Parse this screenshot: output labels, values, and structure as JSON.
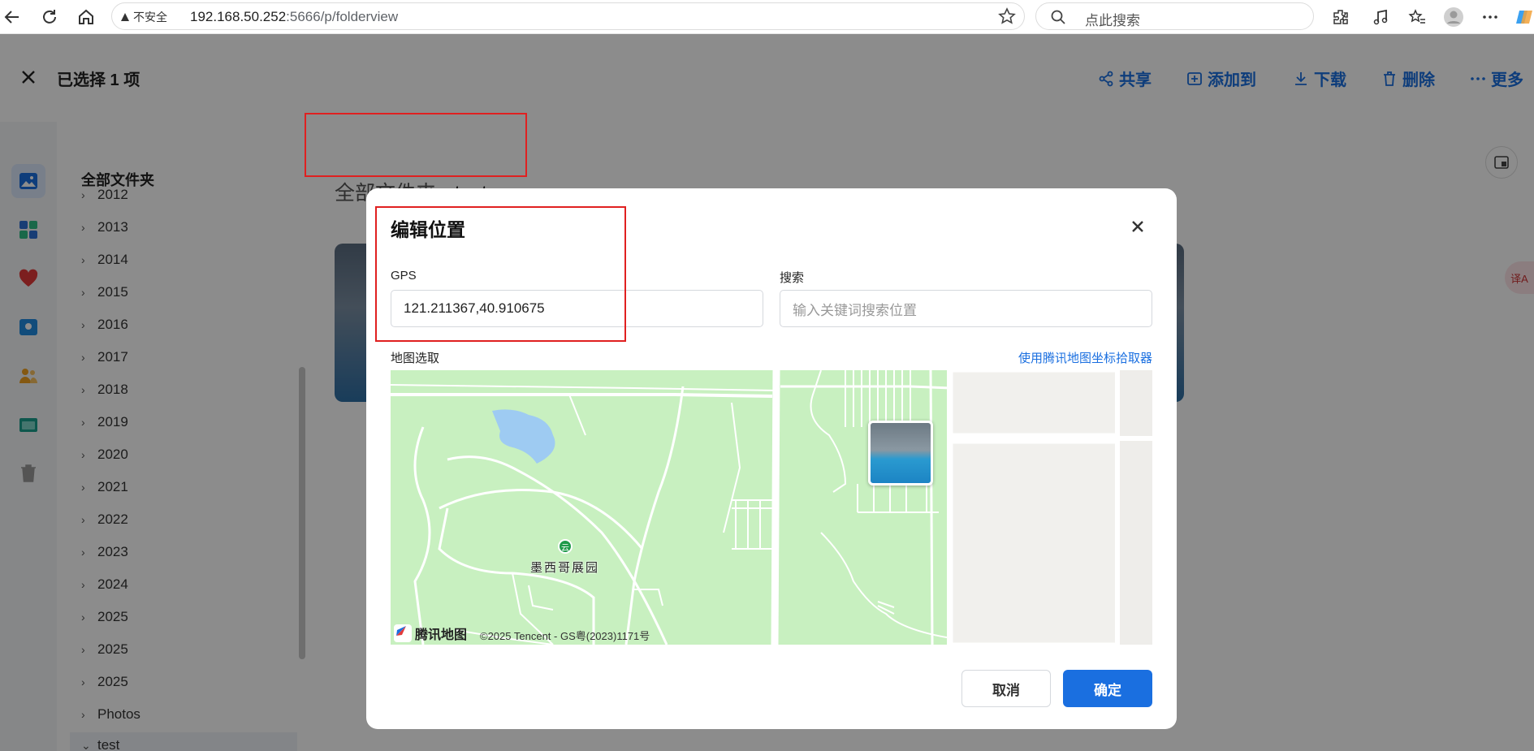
{
  "browser": {
    "insecure_label": "不安全",
    "url_host": "192.168.50.252",
    "url_path": ":5666/p/folderview",
    "search_placeholder": "点此搜索"
  },
  "header": {
    "selected_label": "已选择 1 项",
    "actions": {
      "share": "共享",
      "add_to": "添加到",
      "download": "下载",
      "delete": "删除",
      "more": "更多"
    }
  },
  "tree": {
    "heading": "全部文件夹",
    "items": [
      "2012",
      "2013",
      "2014",
      "2015",
      "2016",
      "2017",
      "2018",
      "2019",
      "2020",
      "2021",
      "2022",
      "2023",
      "2024",
      "2025",
      "2025",
      "2025",
      "Photos",
      "test"
    ]
  },
  "breadcrumb": {
    "root": "全部文件夹",
    "separator": "›",
    "current": "test"
  },
  "translate_badge": "译A",
  "modal": {
    "title": "编辑位置",
    "gps_label": "GPS",
    "gps_value": "121.211367,40.910675",
    "search_label": "搜索",
    "search_placeholder": "输入关键词搜索位置",
    "map_label": "地图选取",
    "map_link": "使用腾讯地图坐标拾取器",
    "map_logo_text": "腾讯地图",
    "map_copyright": "©2025 Tencent - GS粤(2023)1171号",
    "poi_name": "墨西哥展园",
    "poi_icon_glyph": "云",
    "cancel": "取消",
    "confirm": "确定"
  },
  "colors": {
    "accent": "#1a6fe0",
    "highlight": "#e02020",
    "map_green": "#c8f0c0",
    "map_water": "#9ecbf2"
  }
}
